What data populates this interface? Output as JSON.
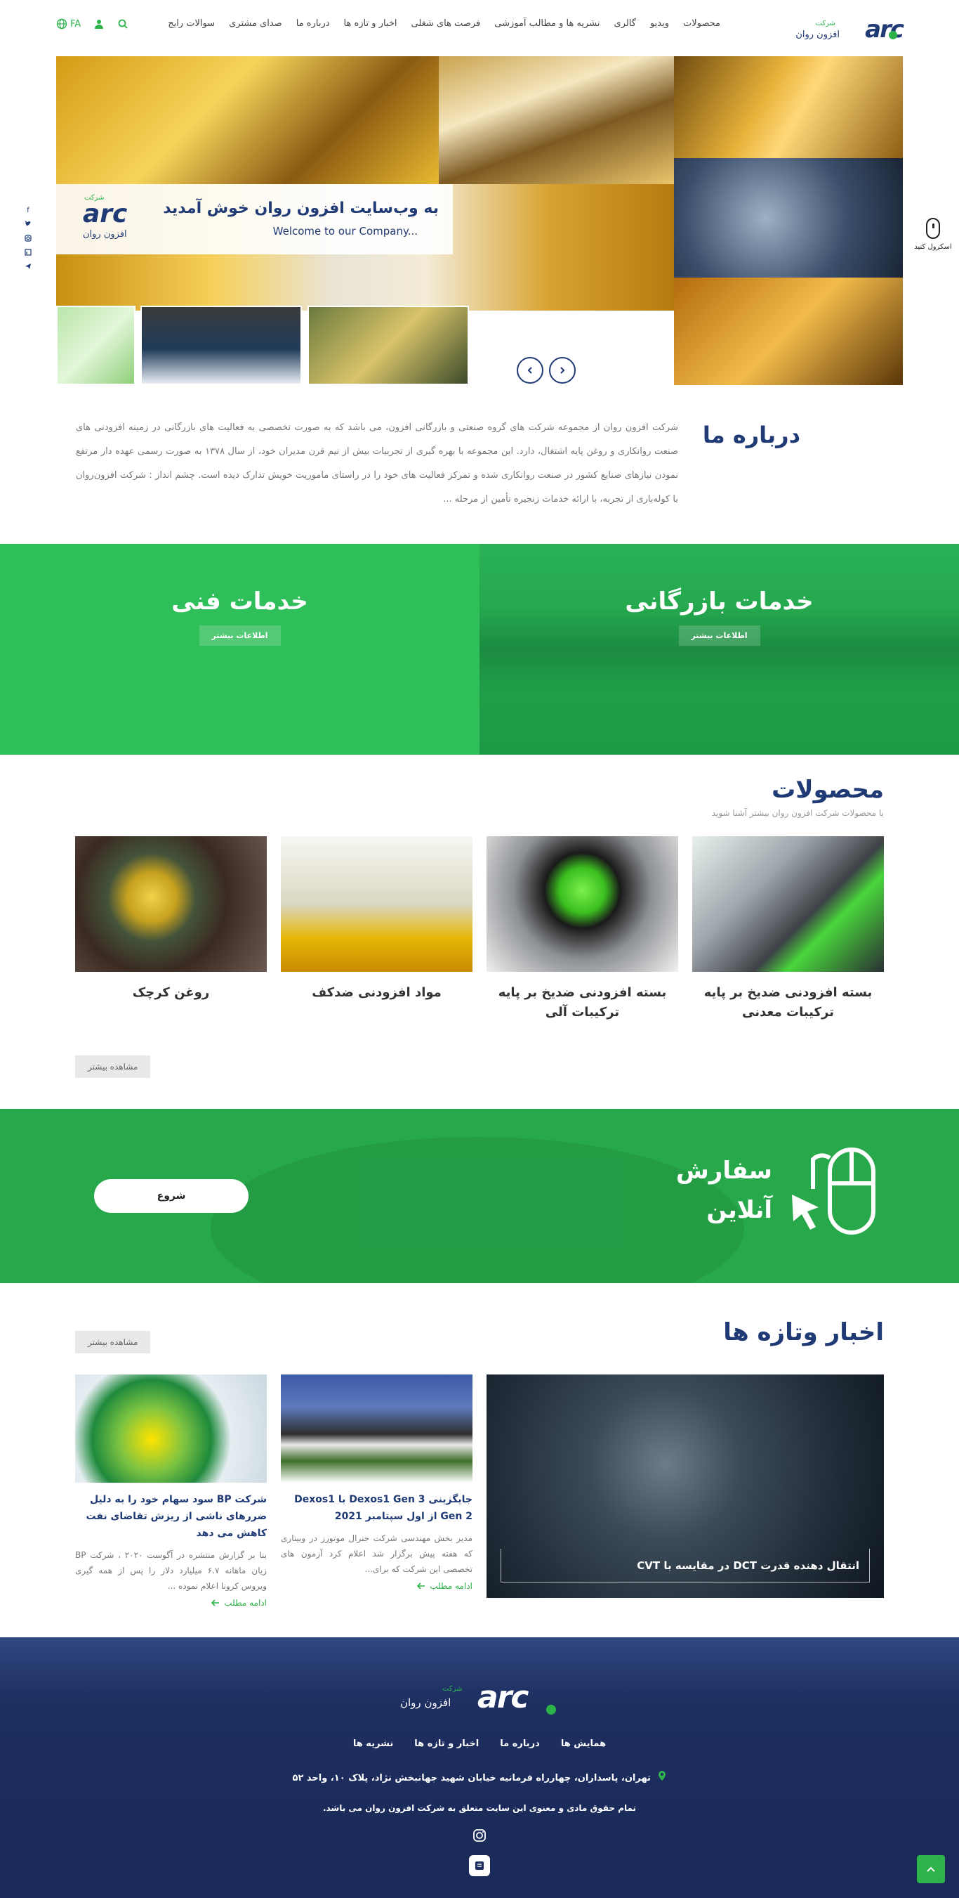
{
  "header": {
    "logo_sub": "شرکت",
    "logo_name": "افزون روان",
    "nav": [
      "محصولات",
      "ویدیو",
      "گالری",
      "نشریه ها و مطالب آموزشی",
      "فرصت های شغلی",
      "اخبار و تازه ها",
      "درباره ما",
      "صدای مشتری",
      "سوالات رایج"
    ],
    "lang": "FA",
    "colors": {
      "brand_blue": "#1f3a74",
      "brand_green": "#2db34a"
    }
  },
  "hero": {
    "welcome_fa": "به وب‌سایت افزون روان خوش آمدید",
    "welcome_en": "Welcome to our Company...",
    "logo_sub": "شرکت",
    "logo_name": "افزون روان"
  },
  "scroll_hint": "اسکرول کنید",
  "about": {
    "title": "درباره ما",
    "text": "شرکت افزون روان از مجموعه شرکت های گروه صنعتی و بازرگانی افزون، می باشد که به صورت تخصصی به فعالیت های بازرگانی در زمینه افزودنی های صنعت روانکاری و روغن پایه اشتغال، دارد. این مجموعه با بهره گیری از تجربیات بیش از نیم قرن مدیران خود، از سال ۱۳۷۸ به صورت رسمی عهده دار مرتفع نمودن نیازهای صنایع کشور در صنعت روانکاری شده و تمرکز فعالیت های خود را در راستای ماموریت خویش تدارک دیده است. چشم انداز : شرکت افزون‌روان با کوله‌باری از تجربه، با ارائه خدمات زنجیره تأمین از مرحله ..."
  },
  "services": {
    "trade_title": "خدمات بازرگانی",
    "tech_title": "خدمات فنی",
    "button": "اطلاعات بیشتر"
  },
  "products": {
    "title": "محصولات",
    "subtitle": "با محصولات شرکت افزون روان بیشتر آشنا شوید",
    "items": [
      "بسته افزودنی ضدیخ بر پایه ترکیبات معدنی",
      "بسته افزودنی ضدیخ بر پایه ترکیبات آلی",
      "مواد افزودنی ضدکف",
      "روغن کرچک"
    ],
    "more": "مشاهده بیشتر"
  },
  "order": {
    "title1": "سفارش",
    "title2": "آنلاین",
    "button": "شروع"
  },
  "news": {
    "title": "اخبار وتازه ها",
    "more": "مشاهده بیشتر",
    "featured": "انتقال دهنده قدرت DCT در مقایسه با CVT",
    "items": [
      {
        "title": "جایگزینی Dexos1 Gen 3 با Dexos1 Gen 2 از اول سپتامبر 2021",
        "text": "مدیر بخش مهندسی شرکت جنرال موتورز در وبیناری که هفته پیش برگزار شد اعلام کرد آزمون های تخصصی این شرکت که برای...",
        "link": "ادامه مطلب"
      },
      {
        "title": "شرکت BP سود سهام خود را به دلیل ضررهای ناشی از ریزش تقاضای نفت کاهش می دهد",
        "text": "بنا بر گزارش منتشره در آگوست ۲۰۲۰ ، شرکت BP زیان ماهانه ۶.۷ میلیارد دلار را پس از همه گیری ویروس کرونا اعلام نموده ...",
        "link": "ادامه مطلب"
      }
    ]
  },
  "footer": {
    "logo_sub": "شرکت",
    "logo_name": "افزون روان",
    "nav": [
      "همایش ها",
      "درباره ما",
      "اخبار و تازه ها",
      "نشریه ها"
    ],
    "address": "تهران، پاسداران، چهارراه فرمانیه خیابان شهید جهانبخش نژاد، پلاک ۱۰، واحد ۵۲",
    "copyright": "تمام حقوق مادی و معنوی این سایت متعلق به شرکت افزون روان می باشد."
  }
}
